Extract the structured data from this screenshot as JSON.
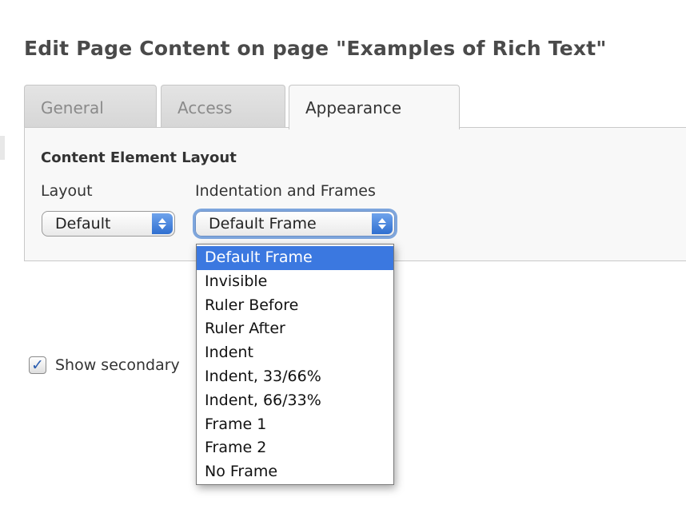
{
  "header": {
    "title": "Edit Page Content on page \"Examples of Rich Text\""
  },
  "tabs": [
    {
      "label": "General",
      "active": false
    },
    {
      "label": "Access",
      "active": false
    },
    {
      "label": "Appearance",
      "active": true
    }
  ],
  "panel": {
    "section_title": "Content Element Layout",
    "layout": {
      "label": "Layout",
      "value": "Default"
    },
    "indentation": {
      "label": "Indentation and Frames",
      "value": "Default Frame",
      "options": [
        "Default Frame",
        "Invisible",
        "Ruler Before",
        "Ruler After",
        "Indent",
        "Indent, 33/66%",
        "Indent, 66/33%",
        "Frame 1",
        "Frame 2",
        "No Frame"
      ],
      "highlighted_index": 0
    }
  },
  "secondary": {
    "label": "Show secondary",
    "checked": true
  },
  "colors": {
    "accent": "#3b78e0",
    "focus_ring": "#7ea6dd"
  },
  "icons": {
    "select_arrows": "select-stepper-icon",
    "checkbox": "checkmark-icon"
  }
}
